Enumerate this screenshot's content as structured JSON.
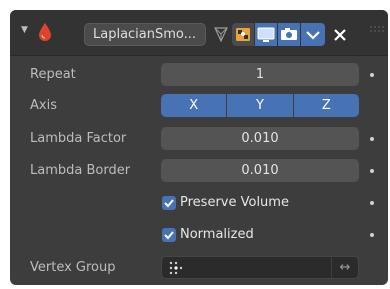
{
  "header": {
    "modifier_name": "LaplacianSmo..."
  },
  "rows": {
    "repeat": {
      "label": "Repeat",
      "value": "1"
    },
    "axis": {
      "label": "Axis",
      "options": [
        "X",
        "Y",
        "Z"
      ]
    },
    "lambda_factor": {
      "label": "Lambda Factor",
      "value": "0.010"
    },
    "lambda_border": {
      "label": "Lambda Border",
      "value": "0.010"
    },
    "preserve_volume": {
      "label": "Preserve Volume",
      "checked": true
    },
    "normalized": {
      "label": "Normalized",
      "checked": true
    },
    "vertex_group": {
      "label": "Vertex Group",
      "value": ""
    }
  },
  "icons": {
    "modifier": "water-drop-icon",
    "edit_mode_cage": "triangle-vertices-icon",
    "edit_mode": "edit-mode-icon",
    "realtime": "monitor-icon",
    "render": "camera-icon",
    "menu": "chevron-down-icon",
    "remove": "close-icon",
    "vertex_group": "vertex-group-icon",
    "invert": "swap-arrows-icon"
  },
  "colors": {
    "panel": "#3d3d3d",
    "header": "#333333",
    "field": "#545454",
    "accent": "#4772b3",
    "modifier_icon": "#e0432c"
  }
}
